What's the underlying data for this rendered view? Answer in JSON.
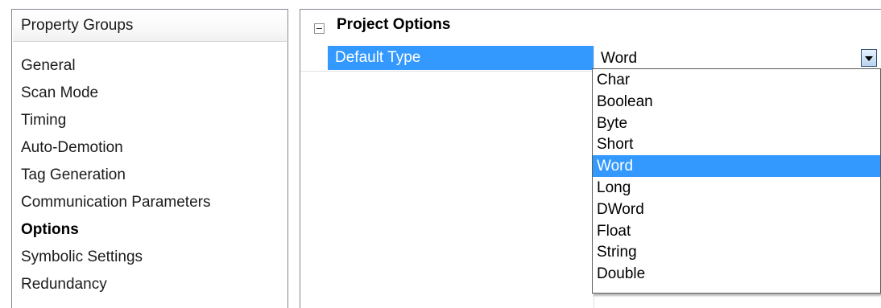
{
  "left_panel": {
    "header": "Property Groups",
    "items": [
      {
        "label": "General",
        "active": false
      },
      {
        "label": "Scan Mode",
        "active": false
      },
      {
        "label": "Timing",
        "active": false
      },
      {
        "label": "Auto-Demotion",
        "active": false
      },
      {
        "label": "Tag Generation",
        "active": false
      },
      {
        "label": "Communication Parameters",
        "active": false
      },
      {
        "label": "Options",
        "active": true
      },
      {
        "label": "Symbolic Settings",
        "active": false
      },
      {
        "label": "Redundancy",
        "active": false
      }
    ]
  },
  "property_grid": {
    "category": {
      "title": "Project Options",
      "expander_icon": "collapse-minus-icon",
      "expanded": true
    },
    "property": {
      "name": "Default Type",
      "value": "Word",
      "dropdown_icon": "dropdown-arrow-icon"
    },
    "dropdown": {
      "options": [
        "Char",
        "Boolean",
        "Byte",
        "Short",
        "Word",
        "Long",
        "DWord",
        "Float",
        "String",
        "Double"
      ],
      "selected": "Word"
    }
  },
  "colors": {
    "selection_blue": "#3399ff",
    "border_gray": "#828790",
    "grid_line": "#e1e1e1"
  }
}
